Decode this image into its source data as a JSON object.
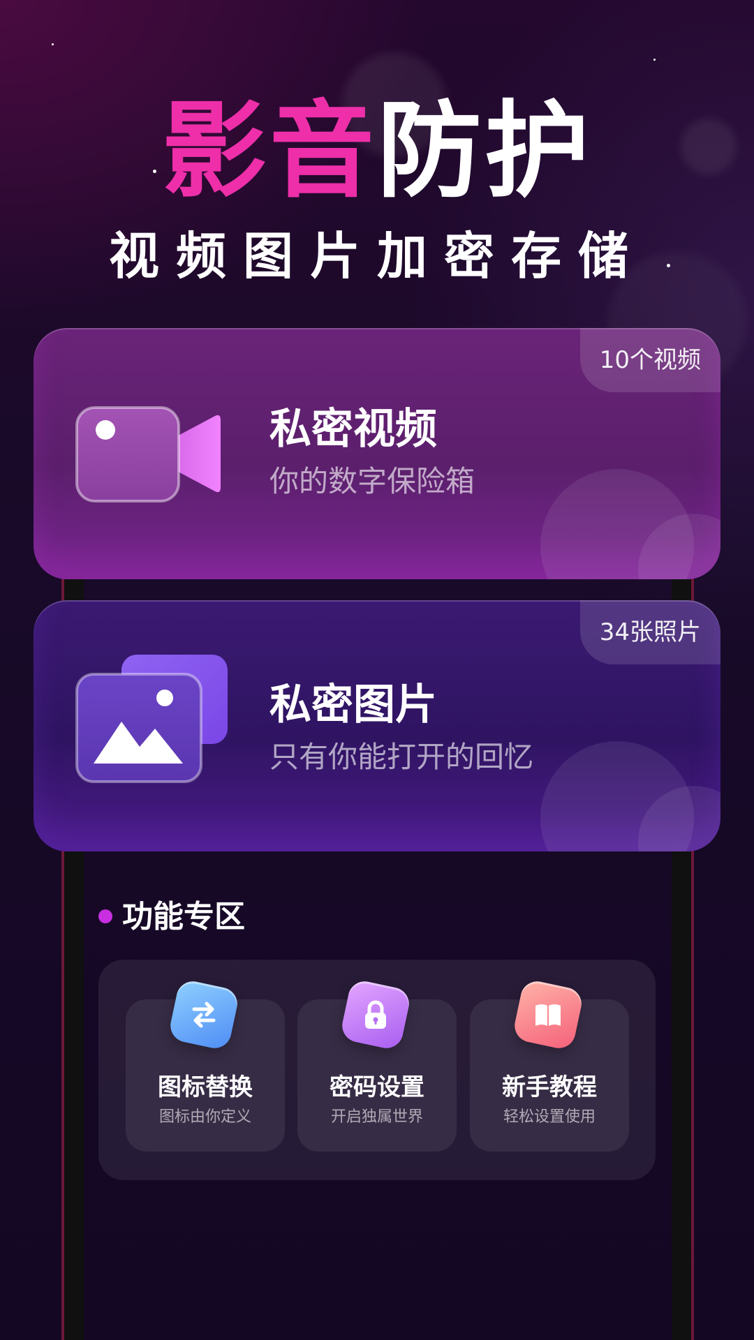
{
  "hero": {
    "title_part1": "影音",
    "title_part2": "防护",
    "subtitle": "视频图片加密存储"
  },
  "cards": [
    {
      "title": "私密视频",
      "subtitle": "你的数字保险箱",
      "badge": "10个视频",
      "icon": "video-camera-icon"
    },
    {
      "title": "私密图片",
      "subtitle": "只有你能打开的回忆",
      "badge": "34张照片",
      "icon": "image-gallery-icon"
    }
  ],
  "section": {
    "title": "功能专区"
  },
  "features": [
    {
      "title": "图标替换",
      "subtitle": "图标由你定义",
      "icon": "swap-icon"
    },
    {
      "title": "密码设置",
      "subtitle": "开启独属世界",
      "icon": "lock-icon"
    },
    {
      "title": "新手教程",
      "subtitle": "轻松设置使用",
      "icon": "book-icon"
    }
  ],
  "colors": {
    "accent_pink": "#ee2fa9",
    "section_dot": "#c72fe0",
    "video_card": "#6a2478",
    "photo_card": "#3b1a72"
  }
}
